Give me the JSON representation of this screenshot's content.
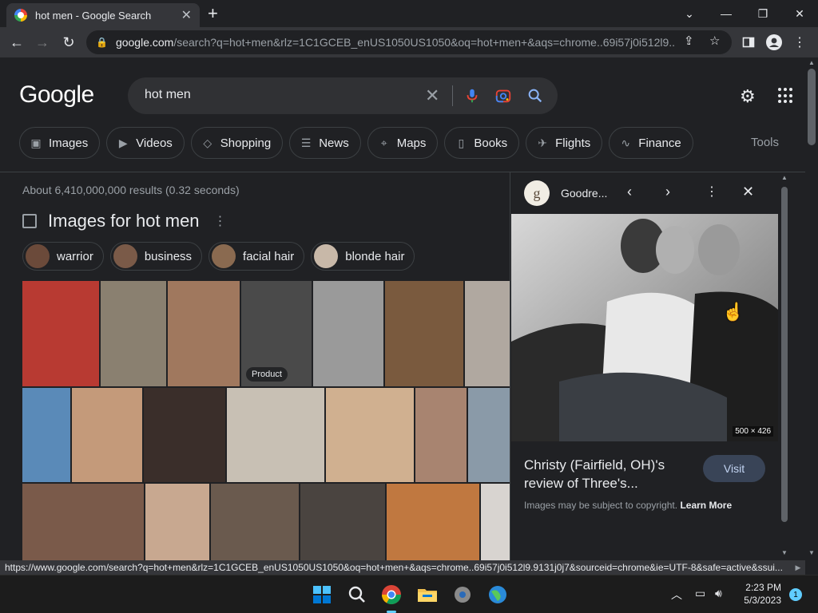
{
  "tab": {
    "title": "hot men - Google Search",
    "close": "✕"
  },
  "window": {
    "new_tab": "+",
    "minimize": "—",
    "restore": "❐",
    "close": "✕",
    "dropdown": "⌄"
  },
  "address": {
    "domain": "google.com",
    "path": "/search?q=hot+men&rlz=1C1GCEB_enUS1050US1050&oq=hot+men+&aqs=chrome..69i57j0i512l9...."
  },
  "google": {
    "logo": "Google",
    "query": "hot men",
    "clear": "✕"
  },
  "chips": [
    {
      "label": "Images",
      "icon": "▣"
    },
    {
      "label": "Videos",
      "icon": "▶"
    },
    {
      "label": "Shopping",
      "icon": "◇"
    },
    {
      "label": "News",
      "icon": "☰"
    },
    {
      "label": "Maps",
      "icon": "⌖"
    },
    {
      "label": "Books",
      "icon": "▯"
    },
    {
      "label": "Flights",
      "icon": "✈"
    },
    {
      "label": "Finance",
      "icon": "∿"
    }
  ],
  "tools_label": "Tools",
  "stats": "About 6,410,000,000 results (0.32 seconds)",
  "images_header": "Images for hot men",
  "refine": [
    {
      "label": "warrior",
      "color": "#6b4a3a"
    },
    {
      "label": "business",
      "color": "#7a5a48"
    },
    {
      "label": "facial hair",
      "color": "#8a6a50"
    },
    {
      "label": "blonde hair",
      "color": "#c8b8a8"
    }
  ],
  "tiles": [
    {
      "label": "",
      "color": "#b83a32"
    },
    {
      "label": "",
      "color": "#8a8070"
    },
    {
      "label": "",
      "color": "#a0785e"
    },
    {
      "label": "Product",
      "color": "#4a4a4a"
    },
    {
      "label": "",
      "color": "#9a9a9a"
    },
    {
      "label": "",
      "color": "#7a5a3e"
    },
    {
      "label": "",
      "color": "#b0a8a0"
    },
    {
      "label": "",
      "color": "#5a8ab8"
    },
    {
      "label": "",
      "color": "#c49a7a"
    },
    {
      "label": "",
      "color": "#3a2e2a"
    },
    {
      "label": "",
      "color": "#c8c0b4"
    },
    {
      "label": "",
      "color": "#d0b090"
    },
    {
      "label": "",
      "color": "#a88470"
    },
    {
      "label": "",
      "color": "#8a9aa8"
    },
    {
      "label": "",
      "color": "#7a5a4a"
    },
    {
      "label": "",
      "color": "#c8a890"
    },
    {
      "label": "",
      "color": "#6a5a4e"
    },
    {
      "label": "",
      "color": "#4a4440"
    },
    {
      "label": "",
      "color": "#c07840"
    },
    {
      "label": "",
      "color": "#d8d4d0"
    }
  ],
  "panel": {
    "source_initial": "g",
    "source_name": "Goodre...",
    "dimensions": "500 × 426",
    "title": "Christy (Fairfield, OH)'s review of Three's...",
    "visit": "Visit",
    "copyright": "Images may be subject to copyright.",
    "learn_more": "Learn More"
  },
  "status_url": "https://www.google.com/search?q=hot+men&rlz=1C1GCEB_enUS1050US1050&oq=hot+men+&aqs=chrome..69i57j0i512l9.9131j0j7&sourceid=chrome&ie=UTF-8&safe=active&ssui...",
  "clock": {
    "time": "2:23 PM",
    "date": "5/3/2023"
  },
  "notifications": "1",
  "colors": {
    "accent": "#8ab4f8",
    "visit_bg": "#394457"
  }
}
